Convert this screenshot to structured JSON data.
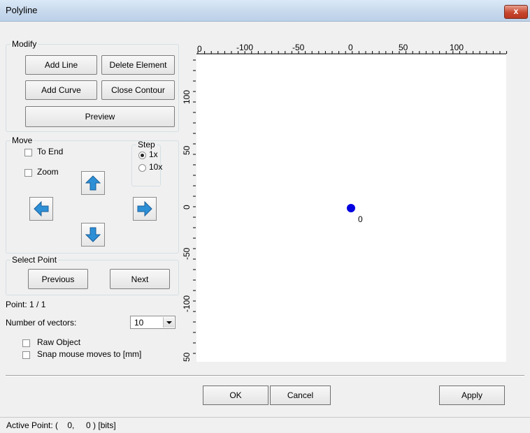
{
  "window": {
    "title": "Polyline",
    "close_label": "x"
  },
  "modify": {
    "legend": "Modify",
    "add_line": "Add Line",
    "delete_element": "Delete Element",
    "add_curve": "Add Curve",
    "close_contour": "Close Contour",
    "preview": "Preview"
  },
  "move": {
    "legend": "Move",
    "to_end": {
      "label": "To End",
      "checked": false
    },
    "zoom": {
      "label": "Zoom",
      "checked": false
    },
    "step": {
      "legend": "Step",
      "options": [
        {
          "label": "1x",
          "selected": true
        },
        {
          "label": "10x",
          "selected": false
        }
      ]
    },
    "arrows": [
      "up",
      "left",
      "right",
      "down"
    ]
  },
  "select_point": {
    "legend": "Select Point",
    "previous": "Previous",
    "next": "Next"
  },
  "point_info": "Point: 1 / 1",
  "vectors": {
    "label": "Number of vectors:",
    "value": "10"
  },
  "raw_object": {
    "label": "Raw Object",
    "checked": false
  },
  "snap": {
    "label": "Snap mouse moves to [mm]",
    "checked": false
  },
  "buttons": {
    "ok": "OK",
    "cancel": "Cancel",
    "apply": "Apply"
  },
  "status": "Active Point: (    0,     0 ) [bits]",
  "canvas": {
    "x_ticks": [
      "0",
      "-100",
      "-50",
      "0",
      "50",
      "100"
    ],
    "y_ticks": [
      "100",
      "50",
      "0",
      "-50",
      "-100",
      "50"
    ],
    "point": {
      "x": 0,
      "y": 0,
      "label": "0",
      "color": "#0000e0"
    }
  }
}
